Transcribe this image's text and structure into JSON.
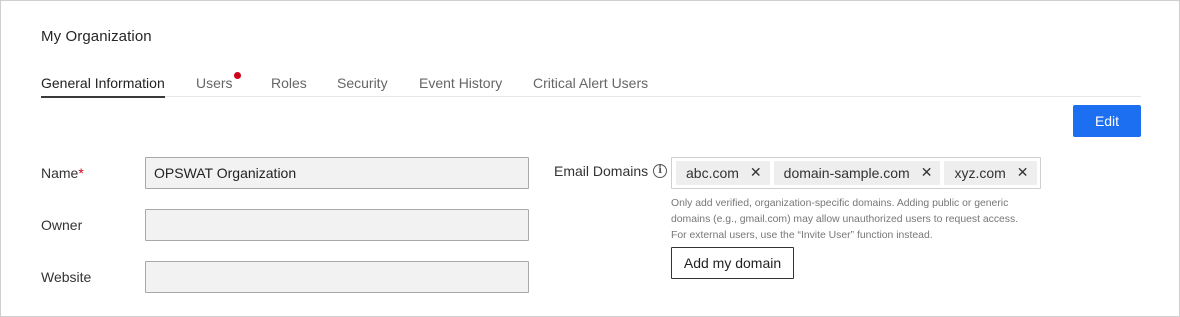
{
  "page": {
    "title": "My Organization"
  },
  "tabs": [
    {
      "label": "General Information",
      "active": true
    },
    {
      "label": "Users",
      "notification": true
    },
    {
      "label": "Roles"
    },
    {
      "label": "Security"
    },
    {
      "label": "Event History"
    },
    {
      "label": "Critical Alert Users"
    }
  ],
  "toolbar": {
    "edit_label": "Edit"
  },
  "form": {
    "name": {
      "label": "Name",
      "required_mark": "*",
      "value": "OPSWAT Organization"
    },
    "owner": {
      "label": "Owner",
      "value": ""
    },
    "website": {
      "label": "Website",
      "value": ""
    }
  },
  "email_domains": {
    "label": "Email Domains",
    "info_icon": "info-circle-icon",
    "tags": [
      "abc.com",
      "domain-sample.com",
      "xyz.com"
    ],
    "remove_icon": "close-icon",
    "help_lines": [
      "Only add verified, organization-specific domains. Adding public or generic",
      "domains (e.g., gmail.com) may allow unauthorized users to request access.",
      "For external users, use the “Invite User” function instead."
    ],
    "add_button_label": "Add my domain"
  },
  "colors": {
    "primary": "#1d6ff2",
    "required": "#d0021b",
    "notification_dot": "#d0021b",
    "tag_background": "#eeeeee",
    "input_background": "#f2f2f2"
  }
}
